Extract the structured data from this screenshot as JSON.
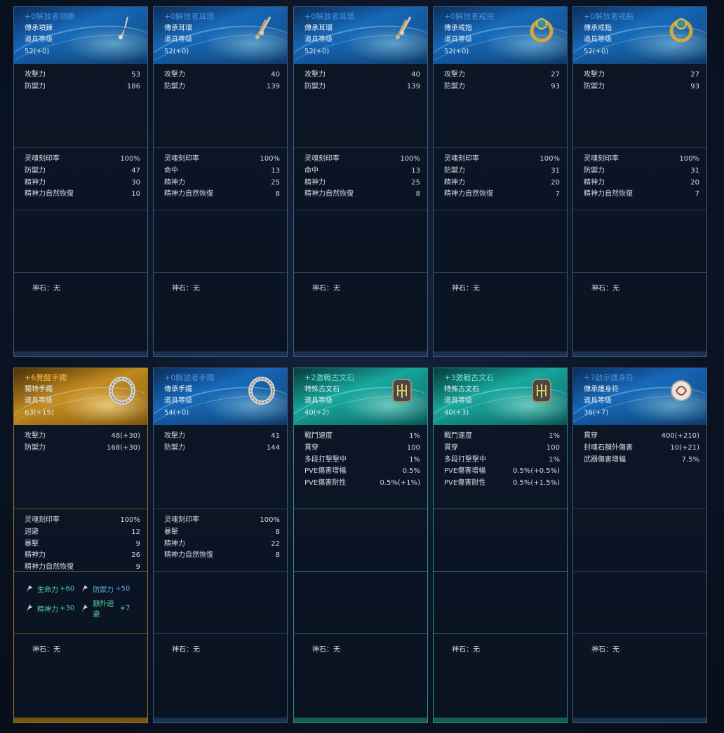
{
  "stone_label": "神石：",
  "cards": [
    {
      "name": "+0解放者項鍊",
      "type": "傳承項鍊",
      "level_label": "道具等级",
      "level": "52(+0)",
      "icon": "necklace-icon",
      "base": [
        [
          "攻擊力",
          "53"
        ],
        [
          "防禦力",
          "186"
        ]
      ],
      "soul": [
        [
          "灵魂刻印率",
          "100%"
        ],
        [
          "防禦力",
          "47"
        ],
        [
          "精神力",
          "30"
        ],
        [
          "精神力自然恢復",
          "10"
        ]
      ],
      "stone": "无"
    },
    {
      "name": "+0解放者耳環",
      "type": "傳承耳環",
      "level_label": "道具等级",
      "level": "52(+0)",
      "icon": "earring-icon",
      "base": [
        [
          "攻擊力",
          "40"
        ],
        [
          "防禦力",
          "139"
        ]
      ],
      "soul": [
        [
          "灵魂刻印率",
          "100%"
        ],
        [
          "命中",
          "13"
        ],
        [
          "精神力",
          "25"
        ],
        [
          "精神力自然恢復",
          "8"
        ]
      ],
      "stone": "无"
    },
    {
      "name": "+0解放者耳環",
      "type": "傳承耳環",
      "level_label": "道具等级",
      "level": "52(+0)",
      "icon": "earring-icon",
      "base": [
        [
          "攻擊力",
          "40"
        ],
        [
          "防禦力",
          "139"
        ]
      ],
      "soul": [
        [
          "灵魂刻印率",
          "100%"
        ],
        [
          "命中",
          "13"
        ],
        [
          "精神力",
          "25"
        ],
        [
          "精神力自然恢復",
          "8"
        ]
      ],
      "stone": "无"
    },
    {
      "name": "+0解放者戒指",
      "type": "傳承戒指",
      "level_label": "道具等级",
      "level": "52(+0)",
      "icon": "ring-icon",
      "base": [
        [
          "攻擊力",
          "27"
        ],
        [
          "防禦力",
          "93"
        ]
      ],
      "soul": [
        [
          "灵魂刻印率",
          "100%"
        ],
        [
          "防禦力",
          "31"
        ],
        [
          "精神力",
          "20"
        ],
        [
          "精神力自然恢復",
          "7"
        ]
      ],
      "stone": "无"
    },
    {
      "name": "+0解放者戒指",
      "type": "傳承戒指",
      "level_label": "道具等级",
      "level": "52(+0)",
      "icon": "ring-icon",
      "base": [
        [
          "攻擊力",
          "27"
        ],
        [
          "防禦力",
          "93"
        ]
      ],
      "soul": [
        [
          "灵魂刻印率",
          "100%"
        ],
        [
          "防禦力",
          "31"
        ],
        [
          "精神力",
          "20"
        ],
        [
          "精神力自然恢復",
          "7"
        ]
      ],
      "stone": "无"
    },
    {
      "name": "+6覺醒手鐲",
      "type": "獨特手鐲",
      "level_label": "道具等级",
      "level": "63(+15)",
      "icon": "bracelet-icon",
      "theme": "gold",
      "base": [
        [
          "攻擊力",
          "48(+30)"
        ],
        [
          "防禦力",
          "168(+30)"
        ]
      ],
      "soul": [
        [
          "灵魂刻印率",
          "100%"
        ],
        [
          "迴避",
          "12"
        ],
        [
          "暴擊",
          "9"
        ],
        [
          "精神力",
          "26"
        ],
        [
          "精神力自然恢復",
          "9"
        ]
      ],
      "bonus": [
        {
          "name": "生命力",
          "value": "+60",
          "color": "green"
        },
        {
          "name": "防禦力",
          "value": "+50",
          "color": "blue"
        },
        {
          "name": "精神力",
          "value": "+30",
          "color": "green"
        },
        {
          "name": "額外迴避",
          "value": "+7",
          "color": "green"
        }
      ],
      "stone": "无"
    },
    {
      "name": "+0解放者手鐲",
      "type": "傳承手鐲",
      "level_label": "道具等级",
      "level": "54(+0)",
      "icon": "bracelet-icon",
      "base": [
        [
          "攻擊力",
          "41"
        ],
        [
          "防禦力",
          "144"
        ]
      ],
      "soul": [
        [
          "灵魂刻印率",
          "100%"
        ],
        [
          "暴擊",
          "8"
        ],
        [
          "精神力",
          "22"
        ],
        [
          "精神力自然恢復",
          "8"
        ]
      ],
      "stone": "无"
    },
    {
      "name": "+2激戰古文石",
      "type": "特殊古文石",
      "level_label": "道具等级",
      "level": "40(+2)",
      "icon": "rune-stone-icon",
      "theme": "cyan",
      "base": [
        [
          "戰鬥速度",
          "1%"
        ],
        [
          "貫穿",
          "100"
        ],
        [
          "多段打擊擊中",
          "1%"
        ],
        [
          "PVE傷害增幅",
          "0.5%"
        ],
        [
          "PVE傷害耐性",
          "0.5%(+1%)"
        ]
      ],
      "soul": [],
      "stone": "无"
    },
    {
      "name": "+3激戰古文石",
      "type": "特殊古文石",
      "level_label": "道具等级",
      "level": "40(+3)",
      "icon": "rune-stone-icon",
      "theme": "cyan",
      "base": [
        [
          "戰鬥速度",
          "1%"
        ],
        [
          "貫穿",
          "100"
        ],
        [
          "多段打擊擊中",
          "1%"
        ],
        [
          "PVE傷害增幅",
          "0.5%(+0.5%)"
        ],
        [
          "PVE傷害耐性",
          "0.5%(+1.5%)"
        ]
      ],
      "soul": [],
      "stone": "无"
    },
    {
      "name": "+7啟示護身符",
      "type": "傳承護身符",
      "level_label": "道具等级",
      "level": "36(+7)",
      "icon": "amulet-icon",
      "base": [
        [
          "貫穿",
          "400(+210)"
        ],
        [
          "封魂石額外傷害",
          "10(+21)"
        ],
        [
          "武器傷害增幅",
          "7.5%"
        ]
      ],
      "soul": [],
      "stone": "无"
    }
  ]
}
